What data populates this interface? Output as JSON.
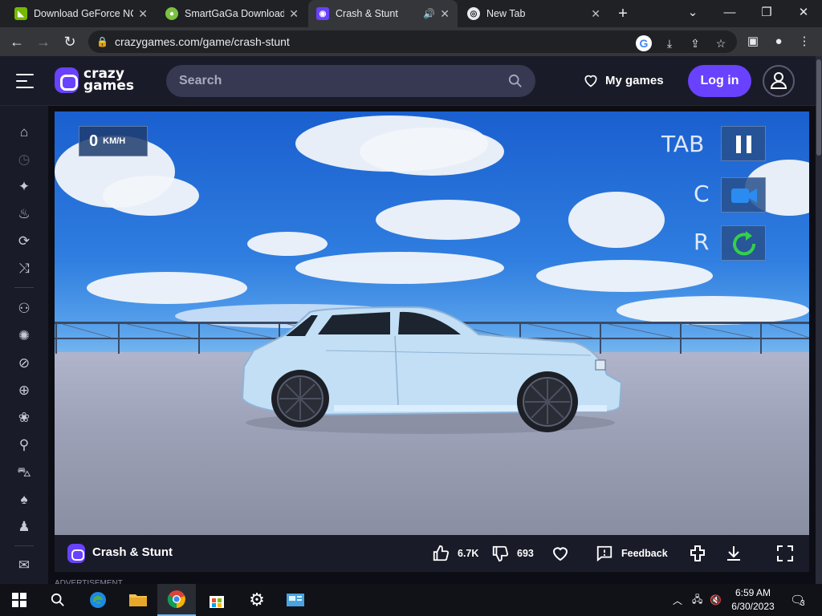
{
  "browser": {
    "tabs": [
      {
        "title": "Download GeForce NOW",
        "favicon_color": "#76b900"
      },
      {
        "title": "SmartGaGa Download",
        "favicon_color": "#7cc242"
      },
      {
        "title": "Crash & Stunt",
        "favicon_color": "#6842ff"
      },
      {
        "title": "New Tab",
        "favicon_color": "#e8eaed"
      }
    ],
    "url": "crazygames.com/game/crash-stunt"
  },
  "site": {
    "logo_line1": "crazy",
    "logo_line2": "games",
    "search_placeholder": "Search",
    "my_games_label": "My games",
    "login_label": "Log in",
    "accent": "#6842ff"
  },
  "game": {
    "speed_value": "0",
    "speed_unit": "KM/H",
    "key_pause": "TAB",
    "key_camera": "C",
    "key_reset": "R",
    "title": "Crash & Stunt",
    "likes": "6.7K",
    "dislikes": "693",
    "feedback_label": "Feedback",
    "advert_label": "ADVERTISEMENT"
  },
  "taskbar": {
    "time": "6:59 AM",
    "date": "6/30/2023",
    "notification_count": "3"
  }
}
